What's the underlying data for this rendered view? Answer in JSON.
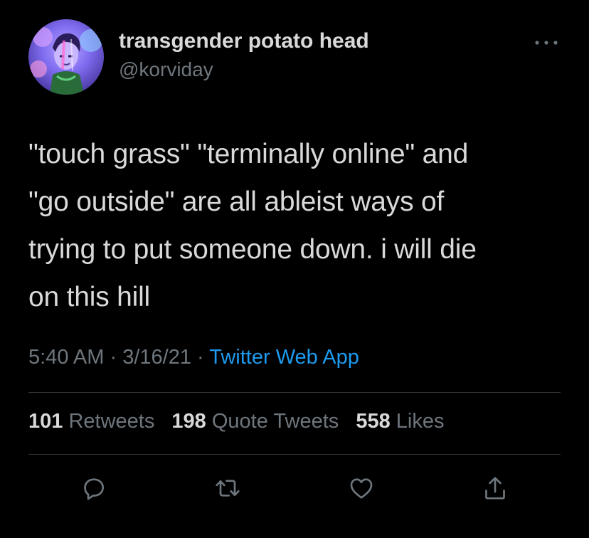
{
  "tweet": {
    "display_name": "transgender potato head",
    "handle": "@korviday",
    "text": "\"touch grass\" \"terminally online\" and\n\"go outside\" are all ableist ways of\ntrying to put someone down. i will die\non this hill",
    "time": "5:40 AM",
    "date": "3/16/21",
    "source": "Twitter Web App",
    "separator": "·"
  },
  "stats": {
    "retweets_count": "101",
    "retweets_label": "Retweets",
    "quote_count": "198",
    "quote_label": "Quote Tweets",
    "likes_count": "558",
    "likes_label": "Likes"
  },
  "actions": {
    "reply_icon": "reply-bubble-icon",
    "retweet_icon": "retweet-icon",
    "like_icon": "heart-icon",
    "share_icon": "share-upload-icon"
  },
  "colors": {
    "background": "#000000",
    "text": "#d9d9d9",
    "secondary": "#6e767d",
    "link": "#1d9bf0",
    "divider": "#2f3336"
  }
}
